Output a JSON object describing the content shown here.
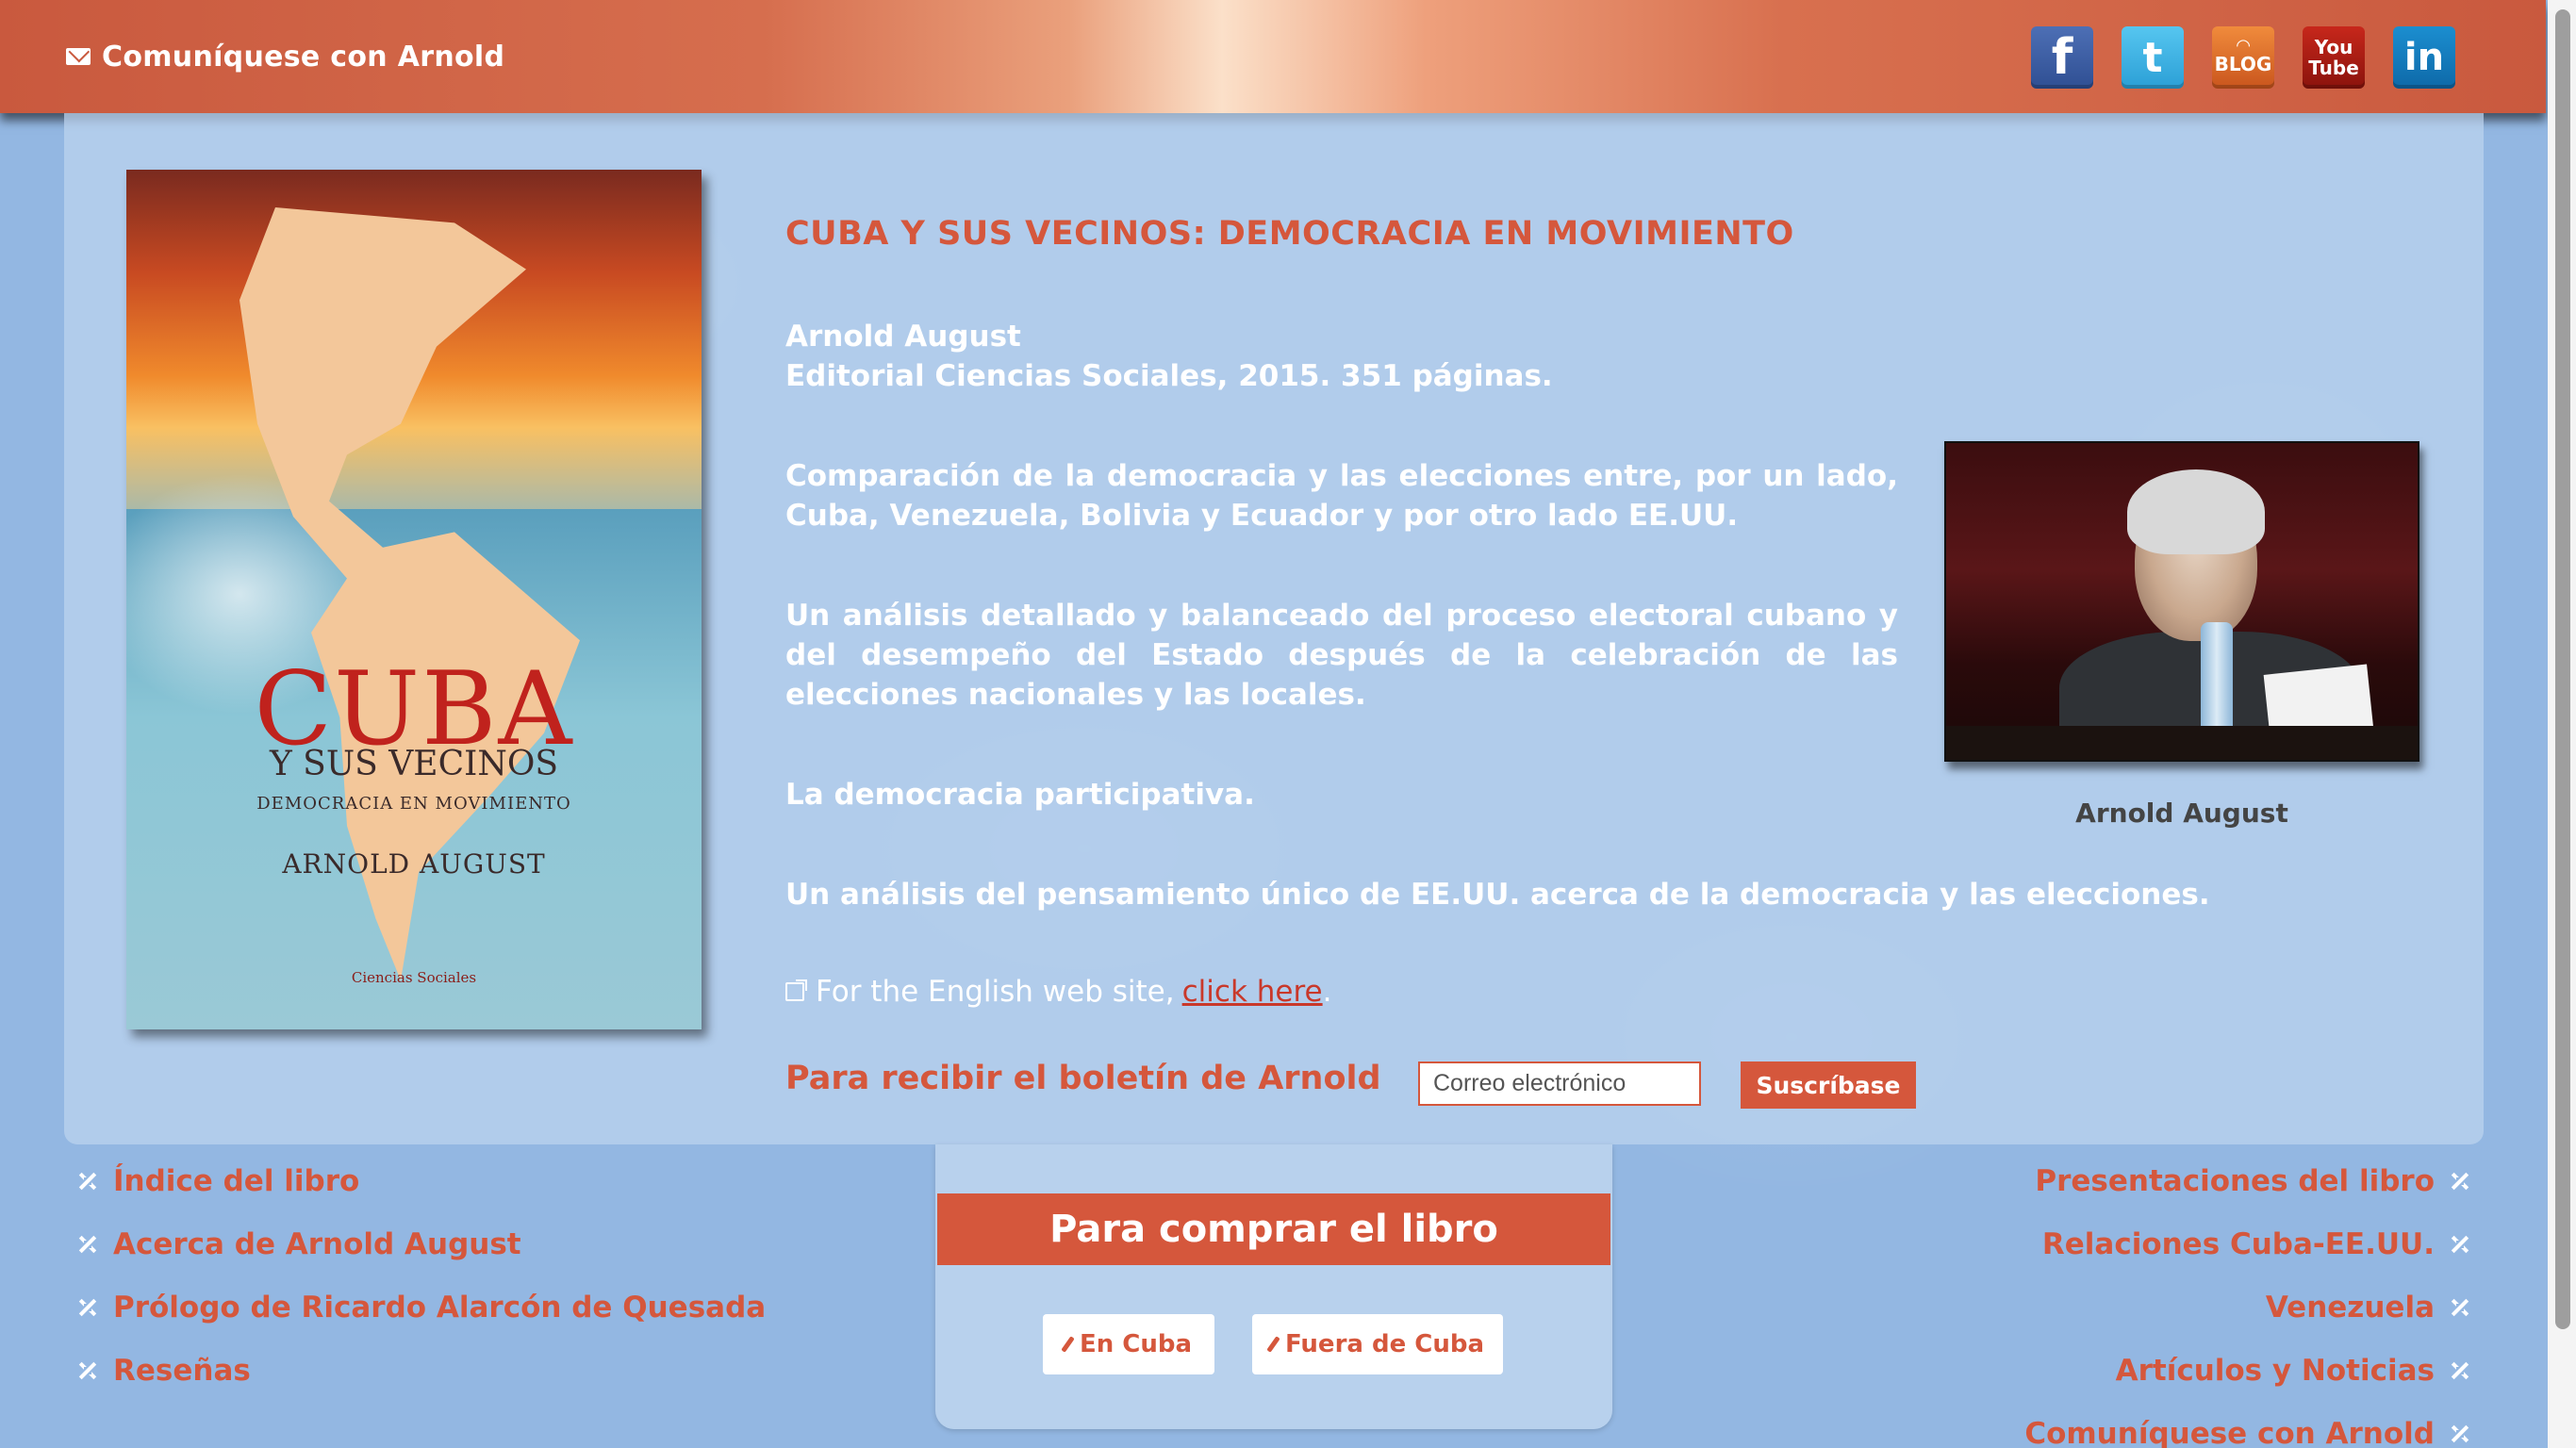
{
  "header": {
    "contact_label": "Comuníquese con Arnold",
    "social": {
      "facebook": "f",
      "twitter": "t",
      "blog": "BLOG",
      "youtube_top": "You",
      "youtube_bottom": "Tube",
      "linkedin": "in"
    },
    "colors": {
      "accent": "#d5573c",
      "header": "#c9593e",
      "background": "#93b7e2"
    }
  },
  "book_cover": {
    "title": "CUBA",
    "subtitle": "Y SUS VECINOS",
    "tagline": "DEMOCRACIA EN MOVIMIENTO",
    "author": "ARNOLD AUGUST",
    "publisher": "Ciencias Sociales"
  },
  "main": {
    "title": "CUBA Y SUS VECINOS: DEMOCRACIA EN MOVIMIENTO",
    "author_line": "Arnold August",
    "publisher_line": "Editorial Ciencias Sociales, 2015. 351 páginas.",
    "paragraph_1": "Comparación de la democracia y las elecciones entre, por un lado, Cuba, Venezuela, Bolivia y Ecuador y por otro lado EE.UU.",
    "paragraph_2": "Un análisis detallado y balanceado del proceso electoral cubano y del desempeño del Estado después de la celebración de las elecciones nacionales y las locales.",
    "paragraph_3": "La democracia participativa.",
    "paragraph_4": "Un análisis del pensamiento único de EE.UU. acerca de la democracia y las elecciones.",
    "english_prefix": "For the English web site,",
    "english_link": "click here",
    "english_suffix": "."
  },
  "photo": {
    "caption": "Arnold August"
  },
  "newsletter": {
    "label": "Para recibir el boletín de Arnold",
    "placeholder": "Correo electrónico",
    "button": "Suscríbase"
  },
  "nav_left": [
    "Índice del libro",
    "Acerca de Arnold August",
    "Prólogo de Ricardo Alarcón de Quesada",
    "Reseñas"
  ],
  "nav_right": [
    "Presentaciones del libro",
    "Relaciones Cuba-EE.UU.",
    "Venezuela",
    "Artículos y Noticias",
    "Comuníquese con Arnold"
  ],
  "buy": {
    "header": "Para comprar el libro",
    "in_cuba": "En Cuba",
    "outside_cuba": "Fuera de Cuba"
  }
}
